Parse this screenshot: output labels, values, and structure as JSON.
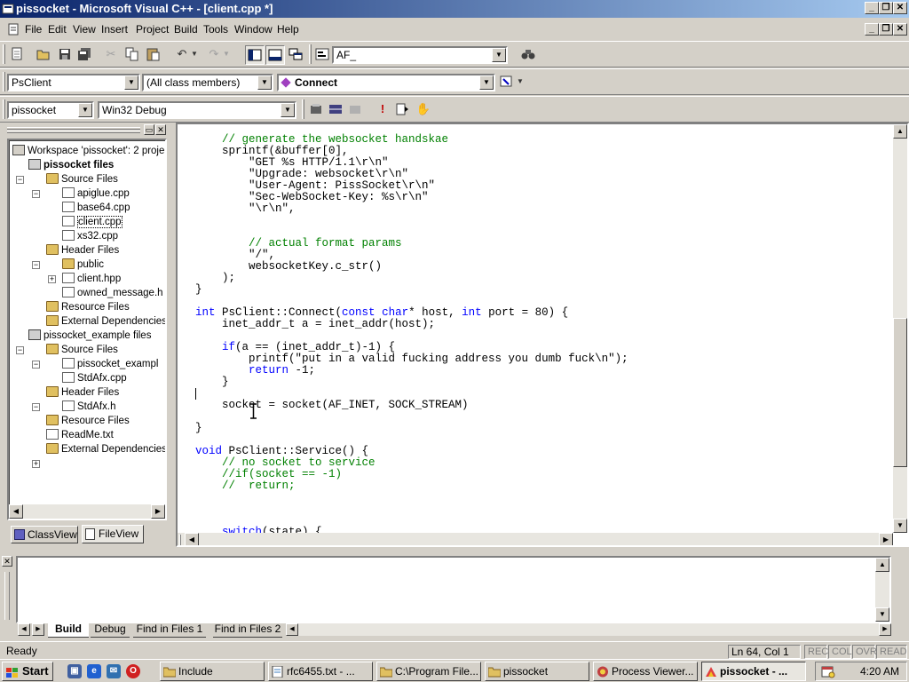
{
  "window": {
    "title": "pissocket - Microsoft Visual C++ - [client.cpp *]"
  },
  "menu": [
    "File",
    "Edit",
    "View",
    "Insert",
    "Project",
    "Build",
    "Tools",
    "Window",
    "Help"
  ],
  "toolbar": {
    "find_combo": "AF_",
    "class_combo": "PsClient",
    "members_combo": "(All class members)",
    "function_combo": "Connect",
    "project_combo": "pissocket",
    "config_combo": "Win32 Debug"
  },
  "workspace": {
    "tree": [
      "Workspace 'pissocket': 2 proje",
      "pissocket files",
      "Source Files",
      "apiglue.cpp",
      "base64.cpp",
      "client.cpp",
      "xs32.cpp",
      "Header Files",
      "public",
      "client.hpp",
      "owned_message.h",
      "Resource Files",
      "External Dependencies",
      "pissocket_example files",
      "Source Files",
      "pissocket_exampl",
      "StdAfx.cpp",
      "Header Files",
      "StdAfx.h",
      "Resource Files",
      "ReadMe.txt",
      "External Dependencies"
    ],
    "tabs": [
      "ClassView",
      "FileView"
    ]
  },
  "editor": {
    "lines": [
      "    // generate the websocket handskae",
      "    sprintf(&buffer[0],",
      "        \"GET %s HTTP/1.1\\r\\n\"",
      "        \"Upgrade: websocket\\r\\n\"",
      "        \"User-Agent: PissSocket\\r\\n\"",
      "        \"Sec-WebSocket-Key: %s\\r\\n\"",
      "        \"\\r\\n\",",
      "",
      "",
      "        // actual format params",
      "        \"/\",",
      "        websocketKey.c_str()",
      "    );",
      "}",
      "",
      "int PsClient::Connect(const char* host, int port = 80) {",
      "    inet_addr_t a = inet_addr(host);",
      "",
      "    if(a == (inet_addr_t)-1) {",
      "        printf(\"put in a valid fucking address you dumb fuck\\n\");",
      "        return -1;",
      "    }",
      "",
      "    socket = socket(AF_INET, SOCK_STREAM)",
      "",
      "}",
      "",
      "void PsClient::Service() {",
      "    // no socket to service",
      "    //if(socket == -1)",
      "    //  return;",
      "",
      "",
      "",
      "    switch(state) {"
    ]
  },
  "output": {
    "tabs": [
      "Build",
      "Debug",
      "Find in Files 1",
      "Find in Files 2"
    ]
  },
  "status": {
    "text": "Ready",
    "position": "Ln 64, Col 1",
    "indicators": [
      "REC",
      "COL",
      "OVR",
      "READ"
    ]
  },
  "taskbar": {
    "start": "Start",
    "tasks": [
      "Include",
      "rfc6455.txt - ...",
      "C:\\Program File...",
      "pissocket",
      "Process Viewer...",
      "pissocket - ..."
    ],
    "clock": "4:20 AM"
  }
}
